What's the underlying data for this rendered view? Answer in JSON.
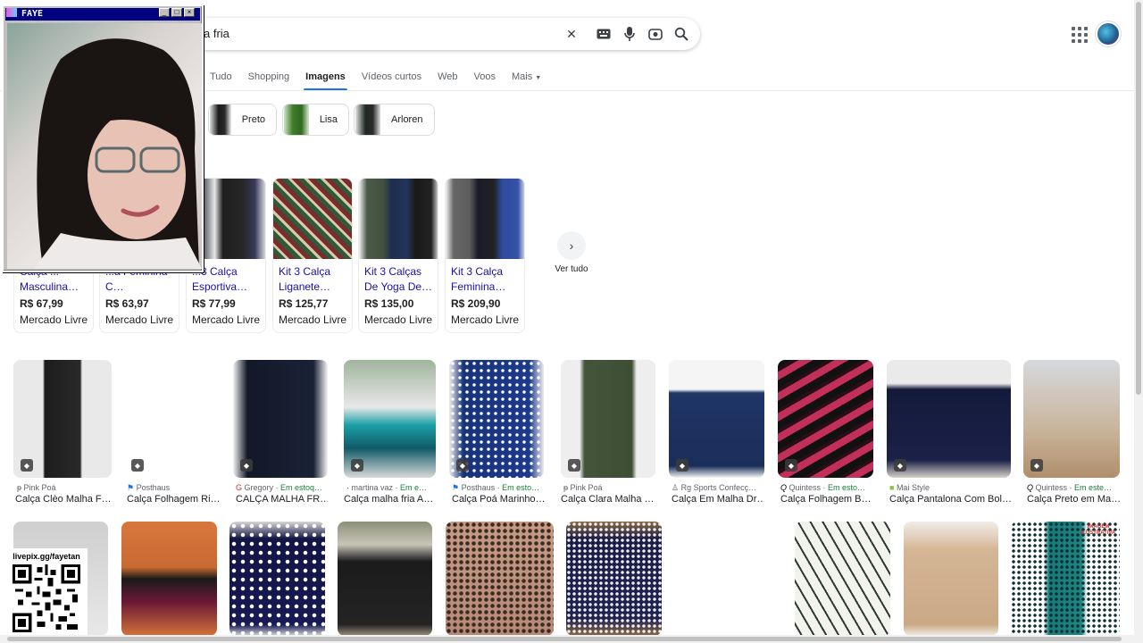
{
  "search": {
    "query": "a fria"
  },
  "tabs": [
    {
      "label": "Tudo"
    },
    {
      "label": "Shopping"
    },
    {
      "label": "Imagens"
    },
    {
      "label": "Vídeos curtos"
    },
    {
      "label": "Web"
    },
    {
      "label": "Voos"
    },
    {
      "label": "Mais"
    }
  ],
  "chips": [
    {
      "label": "Preto"
    },
    {
      "label": "Lisa"
    },
    {
      "label": "Arloren"
    }
  ],
  "products": [
    {
      "title": "Calça ... Masculina…",
      "price": "R$ 67,99",
      "store": "Mercado Livre"
    },
    {
      "title": "...a Feminina C…",
      "price": "R$ 63,97",
      "store": "Mercado Livre"
    },
    {
      "title": "...3 Calça Esportiva…",
      "price": "R$ 77,99",
      "store": "Mercado Livre"
    },
    {
      "title": "Kit 3 Calça Liganete…",
      "price": "R$ 125,77",
      "store": "Mercado Livre"
    },
    {
      "title": "Kit 3 Calças De Yoga De…",
      "price": "R$ 135,00",
      "store": "Mercado Livre"
    },
    {
      "title": "Kit 3 Calça Feminina…",
      "price": "R$ 209,90",
      "store": "Mercado Livre"
    }
  ],
  "see_all": "Ver tudo",
  "images_row1": [
    {
      "source": "Pink Poá",
      "stock": "",
      "title": "Calça Clèo Malha F…"
    },
    {
      "source": "Posthaus",
      "stock": "",
      "title": "Calça Folhagem Ri…"
    },
    {
      "source": "Gregory",
      "stock": "Em estoq…",
      "title": "CALÇA MALHA FR…"
    },
    {
      "source": "martina vaz",
      "stock": "Em e…",
      "title": "Calça malha fria A…"
    },
    {
      "source": "Posthaus",
      "stock": "Em esto…",
      "title": "Calça Poá Marinho…"
    },
    {
      "source": "Pink Poá",
      "stock": "",
      "title": "Calça Clara Malha …"
    },
    {
      "source": "Rg Sports Confecç…",
      "stock": "",
      "title": "Calça Em Malha Dr…"
    },
    {
      "source": "Quintess",
      "stock": "Em esto…",
      "title": "Calça Folhagem B…"
    },
    {
      "source": "Mai Style",
      "stock": "",
      "title": "Calça Pantalona Com Bol…"
    },
    {
      "source": "Quintess",
      "stock": "Em este…",
      "title": "Calça Preto em Ma…"
    }
  ],
  "overlay": {
    "title": "FAYE",
    "qr_caption": "livepix.gg/fayetan"
  },
  "image_badge": "IMAGEM ILUSTRATIVA",
  "colors": {
    "link": "#1a0dab",
    "accent": "#1a73e8",
    "stock": "#188038",
    "window_title": "#000080"
  }
}
